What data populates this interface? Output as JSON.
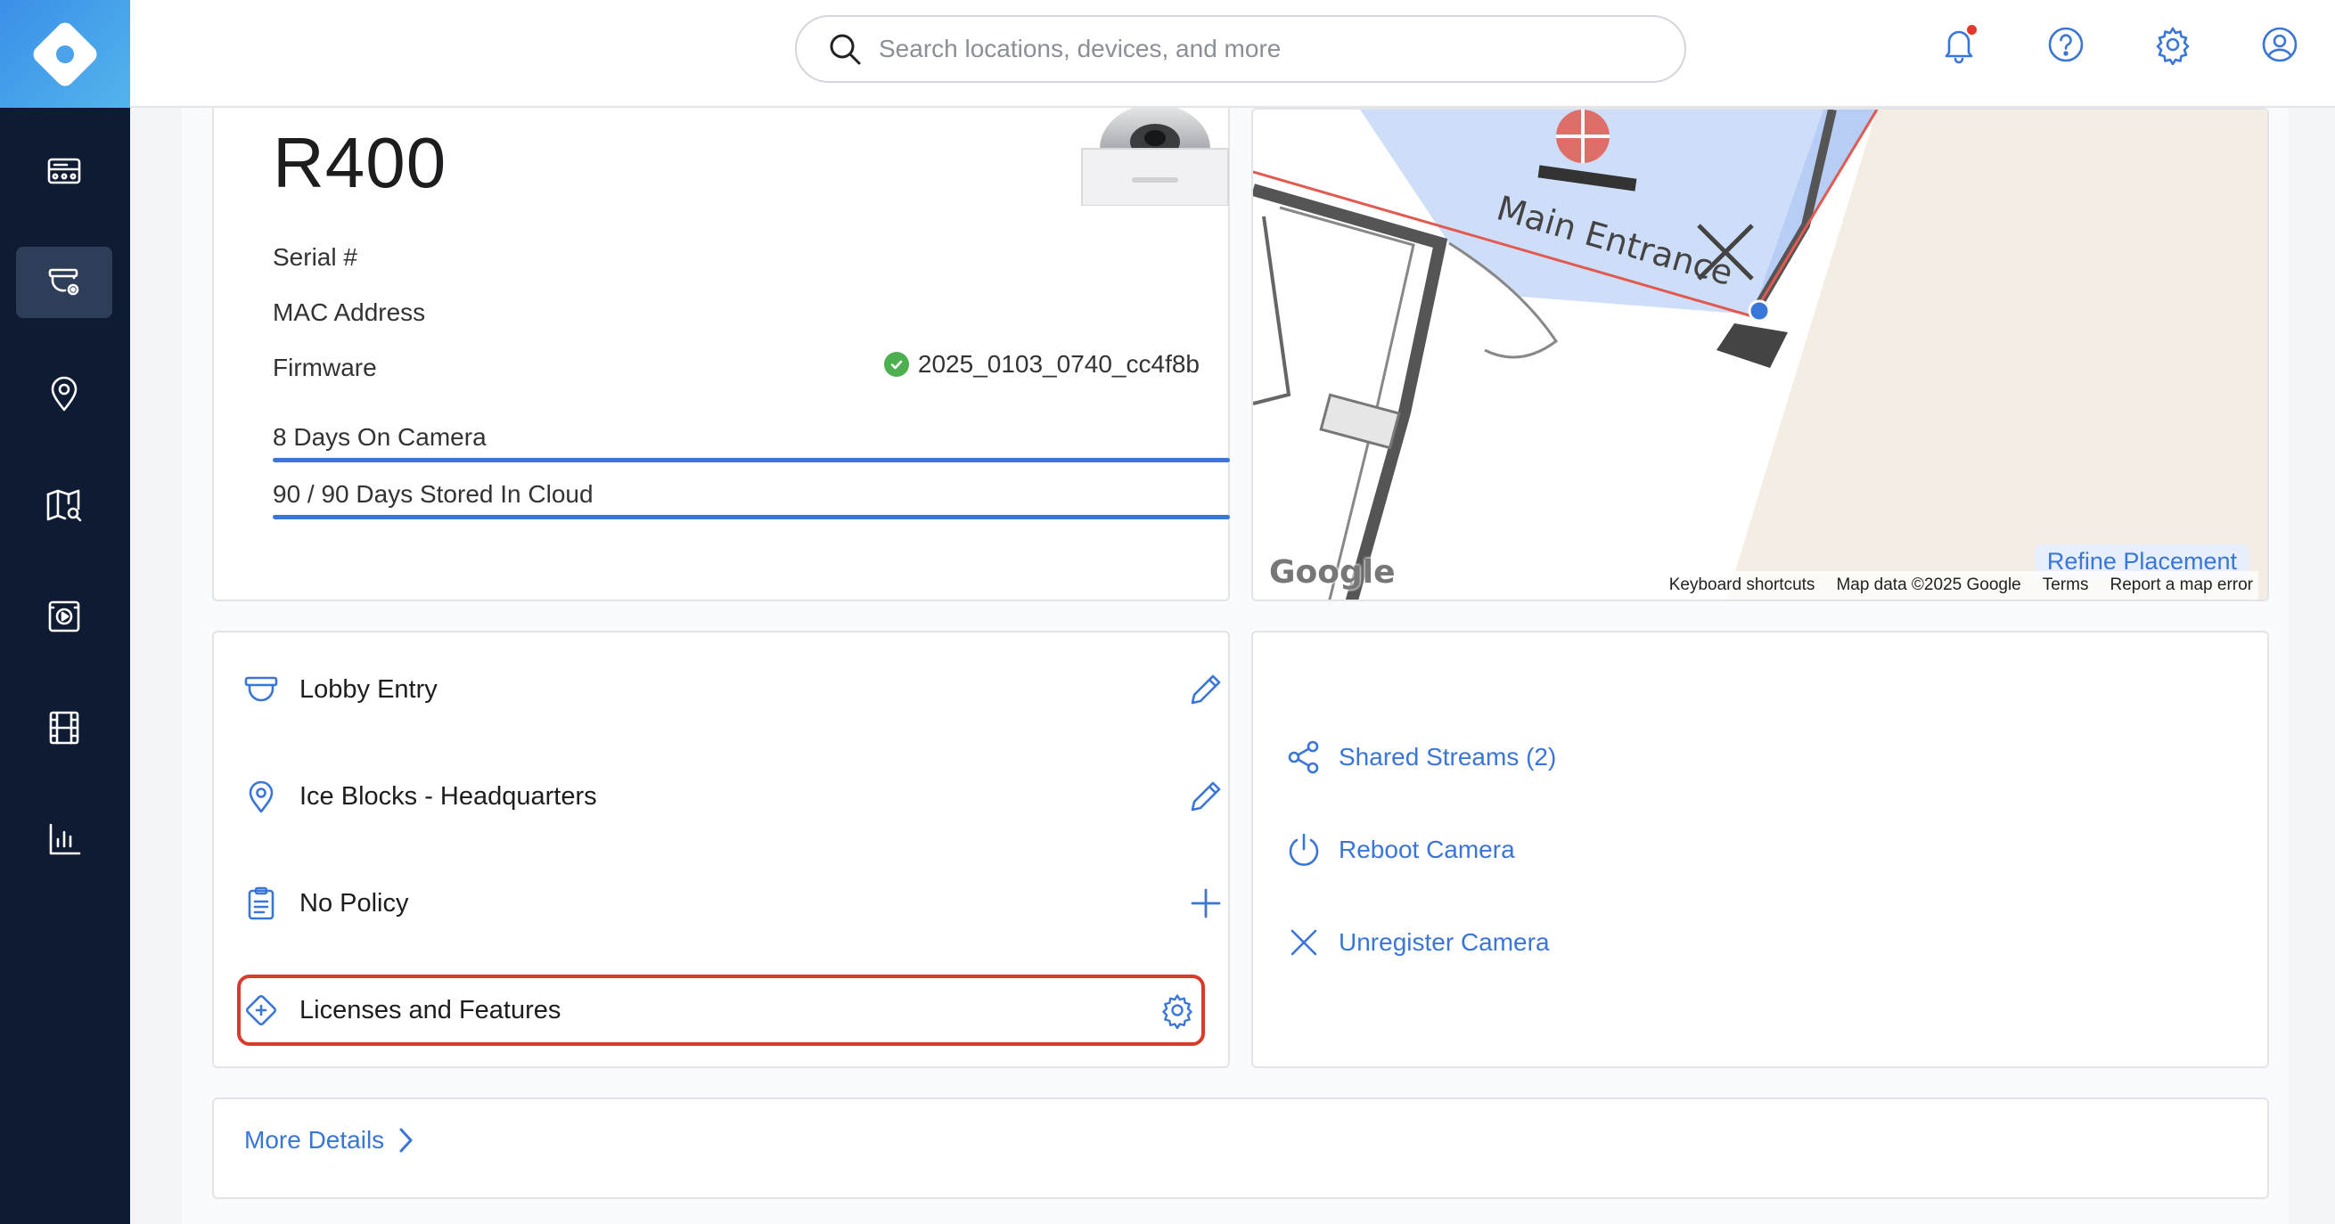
{
  "topbar": {
    "search_placeholder": "Search locations, devices, and more"
  },
  "camera": {
    "model": "R400",
    "serial_label": "Serial #",
    "mac_label": "MAC Address",
    "firmware_label": "Firmware",
    "firmware_value": "2025_0103_0740_cc4f8b",
    "storage": [
      {
        "label": "8 Days On Camera",
        "fill_fraction": 1.0
      },
      {
        "label": "90 / 90 Days Stored In Cloud",
        "fill_fraction": 1.0
      }
    ]
  },
  "map": {
    "entrance_label": "Main Entrance",
    "refine_label": "Refine Placement",
    "google_logo": "Google",
    "footer": [
      "Keyboard shortcuts",
      "Map data ©2025 Google",
      "Terms",
      "Report a map error"
    ]
  },
  "details": {
    "rows": [
      {
        "label": "Lobby Entry",
        "icon": "camera-dome-icon",
        "action": "pencil-icon"
      },
      {
        "label": "Ice Blocks - Headquarters",
        "icon": "location-pin-icon",
        "action": "pencil-icon"
      },
      {
        "label": "No Policy",
        "icon": "clipboard-icon",
        "action": "plus-icon"
      },
      {
        "label": "Licenses and Features",
        "icon": "license-diamond-icon",
        "action": "gear-icon"
      }
    ]
  },
  "actions": [
    {
      "label": "Shared Streams (2)",
      "icon": "share-icon"
    },
    {
      "label": "Reboot Camera",
      "icon": "power-icon"
    },
    {
      "label": "Unregister Camera",
      "icon": "x-icon"
    }
  ],
  "more_details": "More Details",
  "colors": {
    "sidebar": "#0f1b33",
    "accent": "#3a75d8",
    "highlight": "#d93a2b",
    "success": "#4caf50"
  }
}
